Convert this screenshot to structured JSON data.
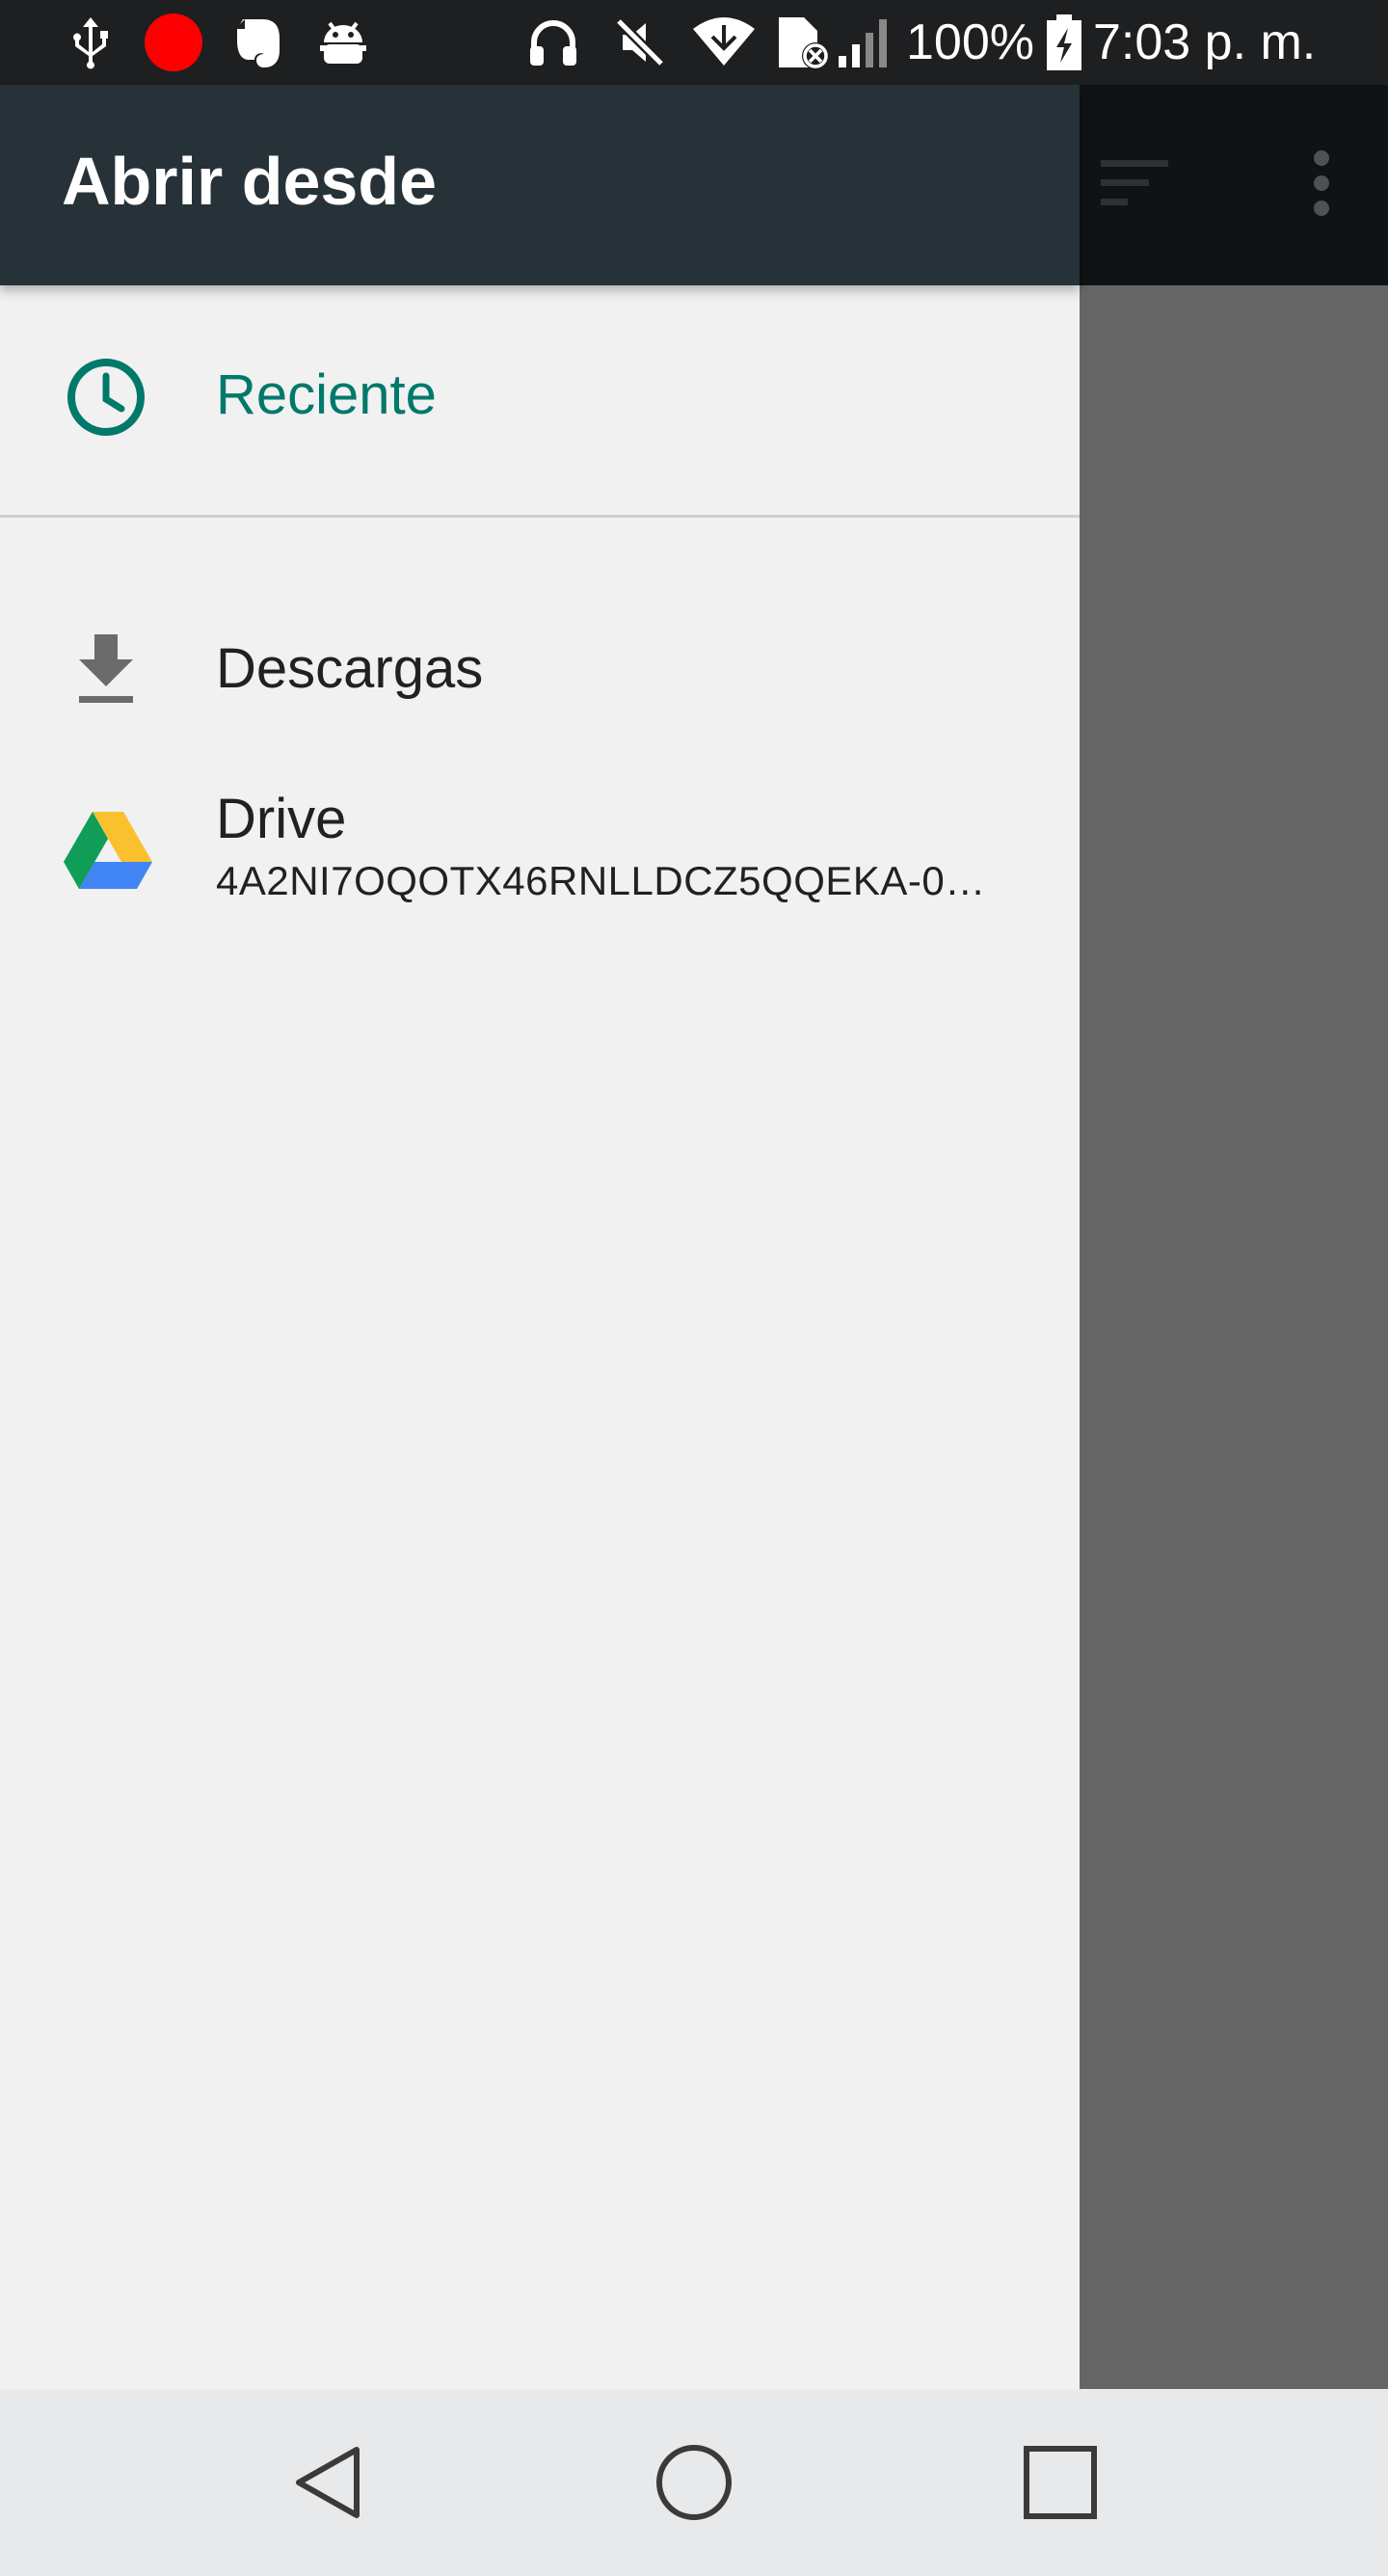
{
  "status_bar": {
    "icons": [
      "usb-icon",
      "record-icon",
      "evernote-icon",
      "android-icon",
      "headphones-icon",
      "mute-icon",
      "wifi-icon",
      "sim-error-icon",
      "signal-icon",
      "battery-icon"
    ],
    "battery_text": "100%",
    "time": "7:03 p. m."
  },
  "drawer": {
    "title": "Abrir desde",
    "items": [
      {
        "label": "Reciente",
        "icon": "clock-icon",
        "selected": true
      },
      {
        "label": "Descargas",
        "icon": "download-icon"
      },
      {
        "label": "Drive",
        "sublabel": "4A2NI7OQOTX46RNLLDCZ5QQEKA-0…",
        "icon": "google-drive-icon"
      }
    ]
  },
  "background_toolbar": {
    "icons": [
      "sort-icon",
      "more-vert-icon"
    ]
  },
  "navigation_bar": {
    "buttons": [
      "back-button",
      "home-button",
      "recents-button"
    ]
  },
  "colors": {
    "accent": "#00796b",
    "header": "#263238",
    "drawer_bg": "#f1f1f1",
    "scrim": "#656565"
  }
}
